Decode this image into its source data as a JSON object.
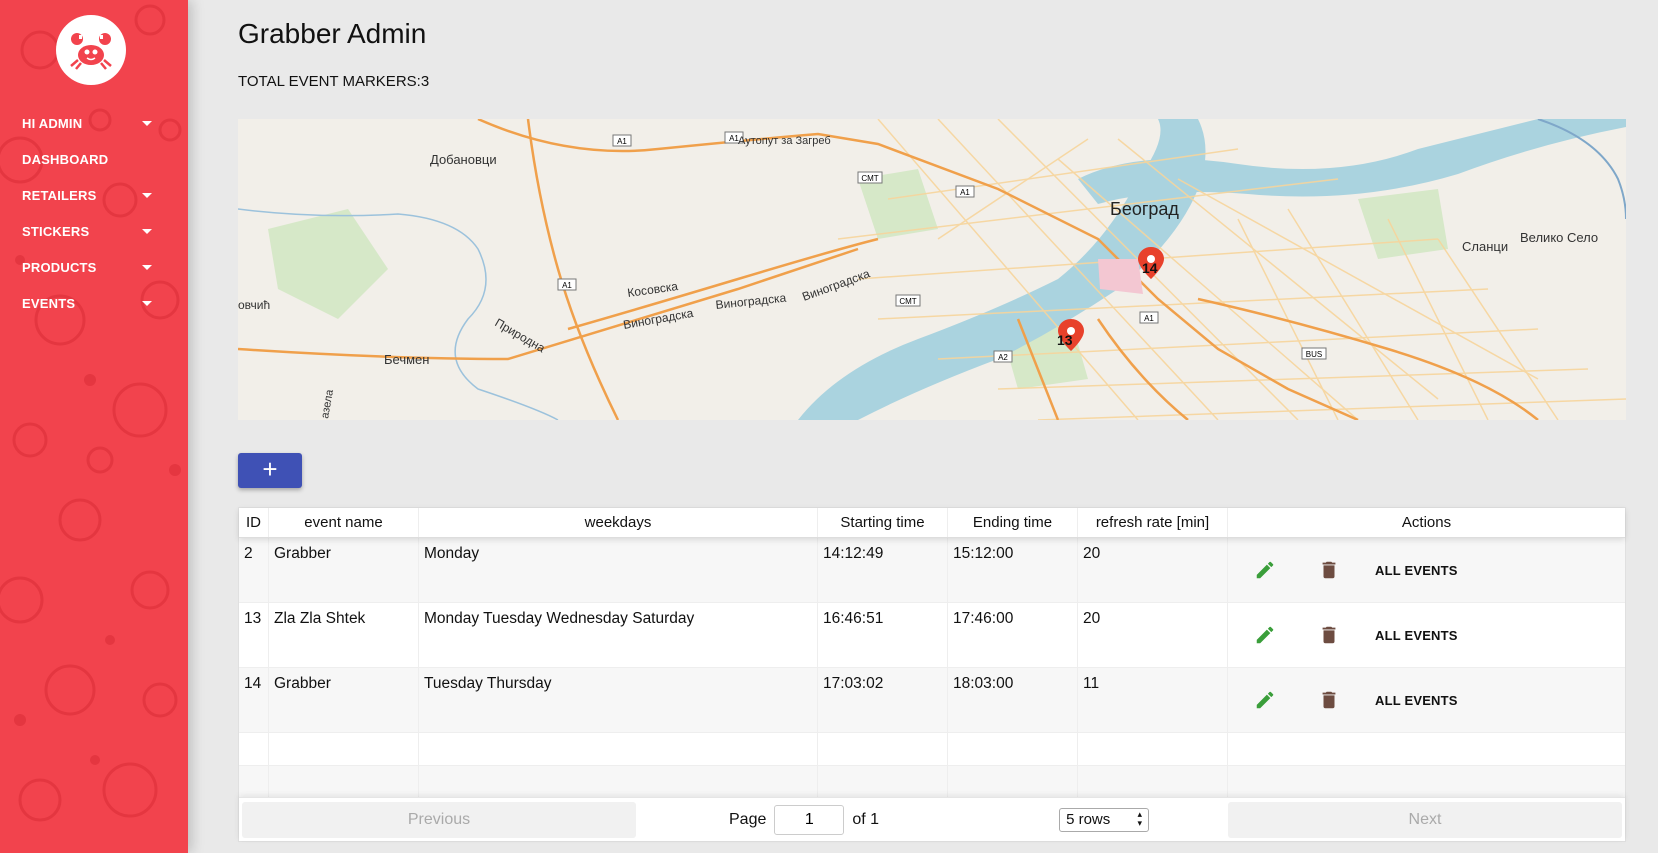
{
  "app": {
    "title": "Grabber Admin"
  },
  "sidebar": {
    "items": [
      {
        "label": "HI ADMIN",
        "caret": true
      },
      {
        "label": "DASHBOARD",
        "caret": false
      },
      {
        "label": "RETAILERS",
        "caret": true
      },
      {
        "label": "STICKERS",
        "caret": true
      },
      {
        "label": "PRODUCTS",
        "caret": true
      },
      {
        "label": "EVENTS",
        "caret": true
      }
    ]
  },
  "summary": {
    "total_label": "TOTAL EVENT MARKERS:3"
  },
  "map": {
    "labels": {
      "city": "Београд",
      "dobanovci": "Добановци",
      "autoput": "Аутопут за Загреб",
      "becmen": "Бечмен",
      "veliko_selo": "Велико Село",
      "slanci": "Сланци",
      "kosovska": "Косовска",
      "vinogradska1": "Виноградска",
      "vinogradska2": "Виноградска",
      "vinogradska3": "Виноградска",
      "prirodna": "Природна",
      "ovcic": "овчић",
      "azela": "азела",
      "a1a": "A1",
      "a1b": "A1",
      "a1c": "A1",
      "a1d": "A1",
      "a1e": "A1",
      "smt1": "СМТ",
      "smt2": "СМТ",
      "a2": "A2",
      "bus": "BUS"
    },
    "markers": [
      {
        "label": "14"
      },
      {
        "label": "13"
      }
    ]
  },
  "add_button": {
    "label": "+"
  },
  "table": {
    "headers": {
      "id": "ID",
      "name": "event name",
      "weekdays": "weekdays",
      "start": "Starting time",
      "end": "Ending time",
      "rate": "refresh rate [min]",
      "actions": "Actions"
    },
    "action_label": "ALL EVENTS",
    "rows": [
      {
        "id": "2",
        "name": "Grabber",
        "weekdays": "Monday",
        "start": "14:12:49",
        "end": "15:12:00",
        "rate": "20"
      },
      {
        "id": "13",
        "name": "Zla Zla Shtek",
        "weekdays": "Monday Tuesday Wednesday Saturday",
        "start": "16:46:51",
        "end": "17:46:00",
        "rate": "20"
      },
      {
        "id": "14",
        "name": "Grabber",
        "weekdays": "Tuesday Thursday",
        "start": "17:03:02",
        "end": "18:03:00",
        "rate": "11"
      }
    ]
  },
  "pagination": {
    "previous": "Previous",
    "next": "Next",
    "page_label": "Page",
    "page_value": "1",
    "of_label": "of 1",
    "rows_select": "5 rows"
  },
  "colors": {
    "sidebar": "#f2434d",
    "accent_button": "#3f51b5",
    "edit_icon": "#3a9e3a",
    "delete_icon": "#6d4c41",
    "marker": "#e8412b"
  },
  "icons": {
    "logo": "crab-logo-icon",
    "edit": "pencil-icon",
    "delete": "trash-icon",
    "marker": "map-pin-icon"
  }
}
